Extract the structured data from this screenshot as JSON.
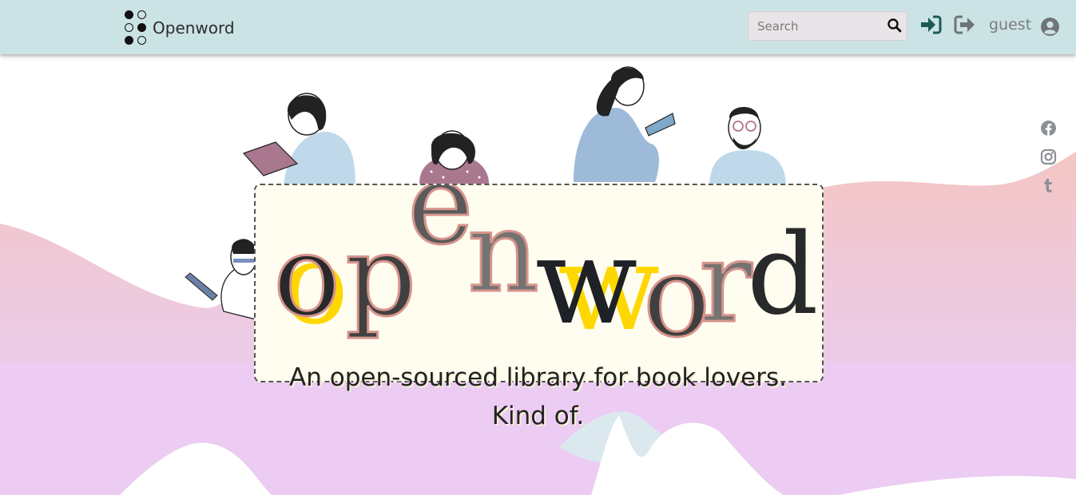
{
  "navbar": {
    "brand": "Openword",
    "search": {
      "placeholder": "Search",
      "value": ""
    },
    "user_label": "guest",
    "icons": [
      "sign-in-icon",
      "sign-out-icon",
      "user-circle-icon",
      "search-icon"
    ]
  },
  "hero": {
    "letters": [
      "o",
      "p",
      "e",
      "n",
      "w",
      "o",
      "r",
      "d"
    ],
    "tagline_line1": "An open-sourced library for book lovers.",
    "tagline_line2": "Kind of."
  },
  "social": [
    "facebook-icon",
    "instagram-icon",
    "tumblr-icon"
  ],
  "colors": {
    "navbar": "#cce3e5",
    "accent_teal": "#1d5a56",
    "yellow": "#ffd700",
    "pink_wave": "#f4c6c4",
    "lilac": "#ecccf2",
    "title_bg": "#fffdef"
  }
}
